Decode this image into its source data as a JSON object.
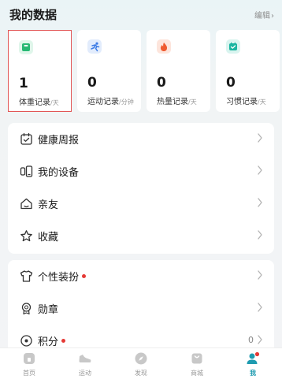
{
  "header": {
    "title": "我的数据",
    "edit_label": "编辑",
    "edit_chevron": "›"
  },
  "stats": [
    {
      "value": "1",
      "label": "体重记录",
      "unit": "/天",
      "icon": "scale-icon",
      "color": "#27b873"
    },
    {
      "value": "0",
      "label": "运动记录",
      "unit": "/分钟",
      "icon": "running-icon",
      "color": "#3c7be6"
    },
    {
      "value": "0",
      "label": "热量记录",
      "unit": "/天",
      "icon": "flame-icon",
      "color": "#ef5a2f"
    },
    {
      "value": "0",
      "label": "习惯记录",
      "unit": "/天",
      "icon": "habit-check-icon",
      "color": "#19b5a0"
    }
  ],
  "menu_group1": [
    {
      "label": "健康周报",
      "icon": "calendar-icon"
    },
    {
      "label": "我的设备",
      "icon": "devices-icon"
    },
    {
      "label": "亲友",
      "icon": "home-people-icon"
    },
    {
      "label": "收藏",
      "icon": "star-icon"
    }
  ],
  "menu_group2": [
    {
      "label": "个性装扮",
      "icon": "tshirt-icon",
      "badge": true
    },
    {
      "label": "勋章",
      "icon": "medal-icon"
    },
    {
      "label": "积分",
      "icon": "points-coin-icon",
      "badge": true,
      "value": "0"
    }
  ],
  "tabs": [
    {
      "label": "首页",
      "icon": "home-icon"
    },
    {
      "label": "运动",
      "icon": "shoe-icon"
    },
    {
      "label": "发现",
      "icon": "compass-icon"
    },
    {
      "label": "商城",
      "icon": "shop-bag-icon"
    },
    {
      "label": "我",
      "icon": "profile-icon",
      "active": true
    }
  ],
  "colors": {
    "accent": "#1e9bb0",
    "badge": "#e53935",
    "highlight_border": "#e25656"
  }
}
